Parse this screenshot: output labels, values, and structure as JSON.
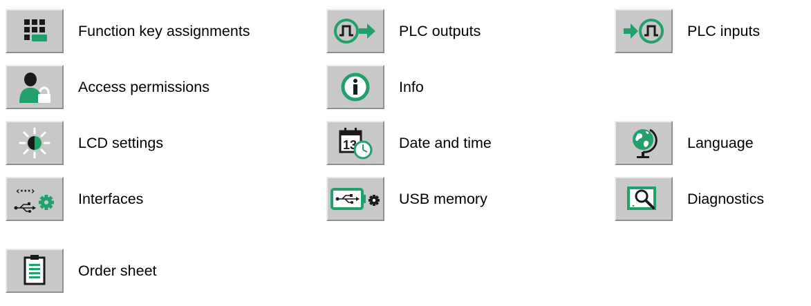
{
  "colors": {
    "accent": "#22a06b",
    "dark": "#1a1a1a",
    "button_face": "#c8c8c8"
  },
  "menu": {
    "function_keys": {
      "label": "Function key assignments",
      "icon": "keypad-icon"
    },
    "plc_outputs": {
      "label": "PLC outputs",
      "icon": "pulse-out-icon"
    },
    "plc_inputs": {
      "label": "PLC inputs",
      "icon": "pulse-in-icon"
    },
    "access": {
      "label": "Access permissions",
      "icon": "user-lock-icon"
    },
    "info": {
      "label": "Info",
      "icon": "info-icon"
    },
    "lcd": {
      "label": "LCD settings",
      "icon": "brightness-icon"
    },
    "datetime": {
      "label": "Date and time",
      "icon": "calendar-clock-icon",
      "calendar_day": "13"
    },
    "language": {
      "label": "Language",
      "icon": "globe-icon"
    },
    "interfaces": {
      "label": "Interfaces",
      "icon": "interfaces-gear-icon",
      "arrow_glyph": "‹···›"
    },
    "usb": {
      "label": "USB memory",
      "icon": "usb-gear-icon"
    },
    "diagnostics": {
      "label": "Diagnostics",
      "icon": "magnifier-screen-icon"
    },
    "order_sheet": {
      "label": "Order sheet",
      "icon": "clipboard-icon"
    }
  }
}
